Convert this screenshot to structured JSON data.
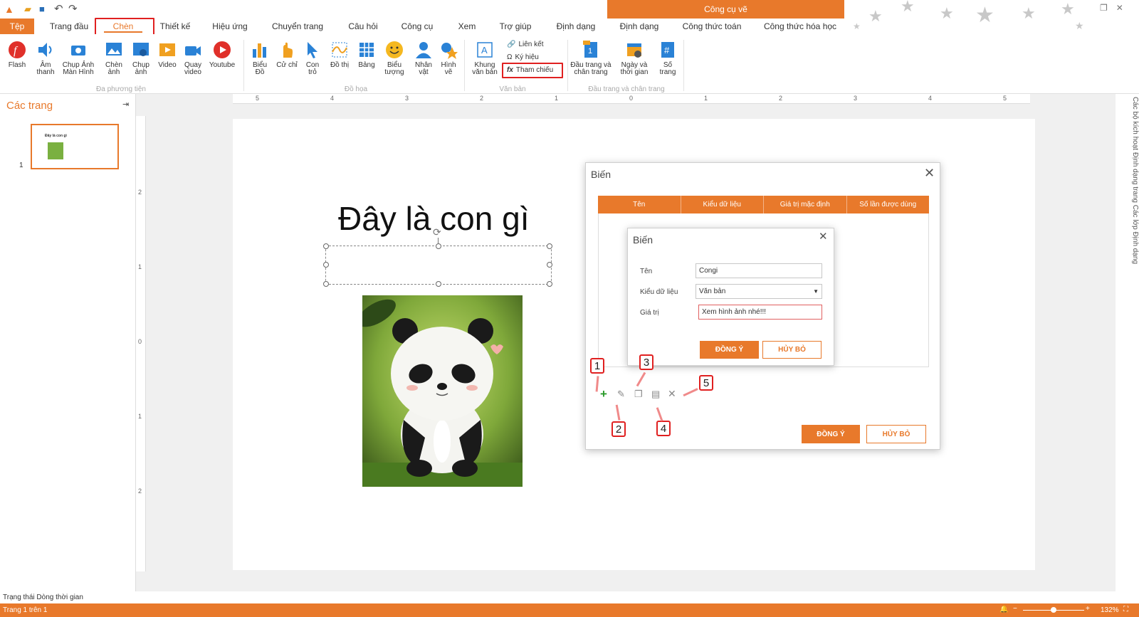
{
  "titlebar": {
    "context_tab": "Công cụ vẽ"
  },
  "tabs": [
    "Tệp",
    "Trang đầu",
    "Chèn",
    "Thiết kế",
    "Hiệu ứng",
    "Chuyển trang",
    "Câu hỏi",
    "Công cụ",
    "Xem",
    "Trợ giúp",
    "Định dạng",
    "Định dạng",
    "Công thức toán",
    "Công thức hóa học"
  ],
  "ribbon": {
    "media": {
      "flash": "Flash",
      "audio": "Âm thanh",
      "screenshot": "Chụp Ảnh Màn Hình",
      "insert_image": "Chèn ảnh",
      "capture_image": "Chụp ảnh",
      "video": "Video",
      "record_video": "Quay video",
      "youtube": "Youtube",
      "group": "Đa phương tiện"
    },
    "graphics": {
      "chart": "Biểu Đồ",
      "gesture": "Cử chỉ",
      "pointer": "Con trỏ",
      "graph": "Đồ thị",
      "table": "Bảng",
      "icon": "Biểu tượng",
      "character": "Nhân vật",
      "shape": "Hình vẽ",
      "group": "Đồ họa"
    },
    "text": {
      "textbox": "Khung văn bản",
      "link": "Liên kết",
      "symbol": "Ký hiệu",
      "reference": "Tham chiếu",
      "group": "Văn bản"
    },
    "header": {
      "header_footer": "Đầu trang và chân trang",
      "datetime": "Ngày và thời gian",
      "page_number": "Số trang",
      "group": "Đầu trang và chân trang"
    }
  },
  "left_panel": {
    "title": "Các trang",
    "page_number": "1",
    "thumb_title": "Đây là con gì"
  },
  "ruler_top": [
    "5",
    "4",
    "3",
    "2",
    "1",
    "0",
    "1",
    "2",
    "3",
    "4",
    "5"
  ],
  "ruler_left": [
    "2",
    "1",
    "0",
    "1",
    "2"
  ],
  "slide": {
    "title": "Đây là con gì"
  },
  "right_panel": "Các bộ kích hoạt  Định dạng trang  Các lớp  Định dạng",
  "outer_dialog": {
    "title": "Biến",
    "columns": [
      "Tên",
      "Kiểu dữ liệu",
      "Giá trị mặc định",
      "Số lần được dùng"
    ],
    "ok": "ĐỒNG Ý",
    "cancel": "HỦY BỎ"
  },
  "inner_dialog": {
    "title": "Biến",
    "name_label": "Tên",
    "name_value": "Congi",
    "type_label": "Kiểu dữ liệu",
    "type_value": "Văn bản",
    "value_label": "Giá trị",
    "value_value": "Xem hình ảnh nhé!!!",
    "ok": "ĐỒNG Ý",
    "cancel": "HỦY BỎ"
  },
  "annotations": [
    "1",
    "2",
    "3",
    "4",
    "5"
  ],
  "status": {
    "tabs": "Trạng thái  Dòng thời gian",
    "page": "Trang 1 trên 1",
    "zoom": "132%"
  },
  "colors": {
    "accent": "#e8792b",
    "highlight": "#e02020"
  }
}
